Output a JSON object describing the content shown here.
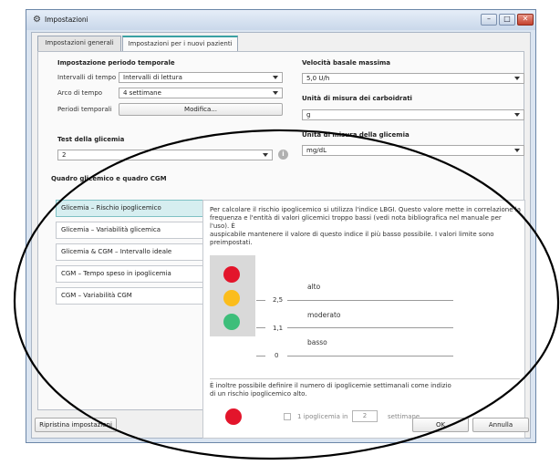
{
  "window": {
    "title": "Impostazioni",
    "buttons": {
      "minimize": "–",
      "maximize": "□",
      "close": "✕"
    }
  },
  "tabs": [
    {
      "label": "Impostazioni generali",
      "active": false
    },
    {
      "label": "Impostazioni per i nuovi pazienti",
      "active": true
    }
  ],
  "period": {
    "heading": "Impostazione periodo temporale",
    "interval_label": "Intervalli di tempo",
    "interval_value": "Intervalli di lettura",
    "range_label": "Arco di tempo",
    "range_value": "4 settimane",
    "periods_label": "Periodi temporali",
    "periods_button": "Modifica..."
  },
  "basal": {
    "heading": "Velocità basale massima",
    "value": "5,0 U/h"
  },
  "carb": {
    "heading": "Unità di misura dei carboidrati",
    "value": "g"
  },
  "glucose_unit": {
    "heading": "Unità di misura della glicemia",
    "value": "mg/dL"
  },
  "bg_test": {
    "heading": "Test della glicemia",
    "value": "2",
    "info_icon": "i"
  },
  "report": {
    "heading": "Quadro glicemico e quadro CGM",
    "items": [
      {
        "label": "Glicemia – Rischio ipoglicemico",
        "selected": true
      },
      {
        "label": "Glicemia – Variabilità glicemica",
        "selected": false
      },
      {
        "label": "Glicemia & CGM – Intervallo ideale",
        "selected": false
      },
      {
        "label": "CGM – Tempo speso in ipoglicemia",
        "selected": false
      },
      {
        "label": "CGM – Variabilità CGM",
        "selected": false
      }
    ]
  },
  "detail": {
    "description_lines": [
      "Per calcolare il rischio ipoglicemico si utilizza l'indice LBGI. Questo valore mette in correlazione la",
      "frequenza e l'entità di valori glicemici troppo bassi (vedi nota bibliografica nel manuale per l'uso). È",
      "auspicabile mantenere il valore di questo indice il più basso possibile. I valori limite sono",
      "preimpostati."
    ],
    "levels": {
      "high": "alto",
      "moderate": "moderato",
      "low": "basso"
    },
    "thresholds": {
      "upper": "2,5",
      "lower": "1,1",
      "zero": "0"
    },
    "extra_lines": [
      "È inoltre possibile definire il numero di ipoglicemie settimanali come indizio",
      "di un rischio ipoglicemico alto."
    ],
    "weekly": {
      "checkbox_label": "1 ipoglicemia in",
      "weeks_value": "2",
      "weeks_unit": "settimane",
      "checked": false
    }
  },
  "footer": {
    "reset": "Ripristina impostazioni",
    "ok": "OK",
    "cancel": "Annulla"
  },
  "colors": {
    "red": "#e3152b",
    "yellow": "#fbbd1c",
    "green": "#3dbe7a",
    "accent_tab": "#3aa1a3",
    "selected_item": "#d6eef0"
  }
}
